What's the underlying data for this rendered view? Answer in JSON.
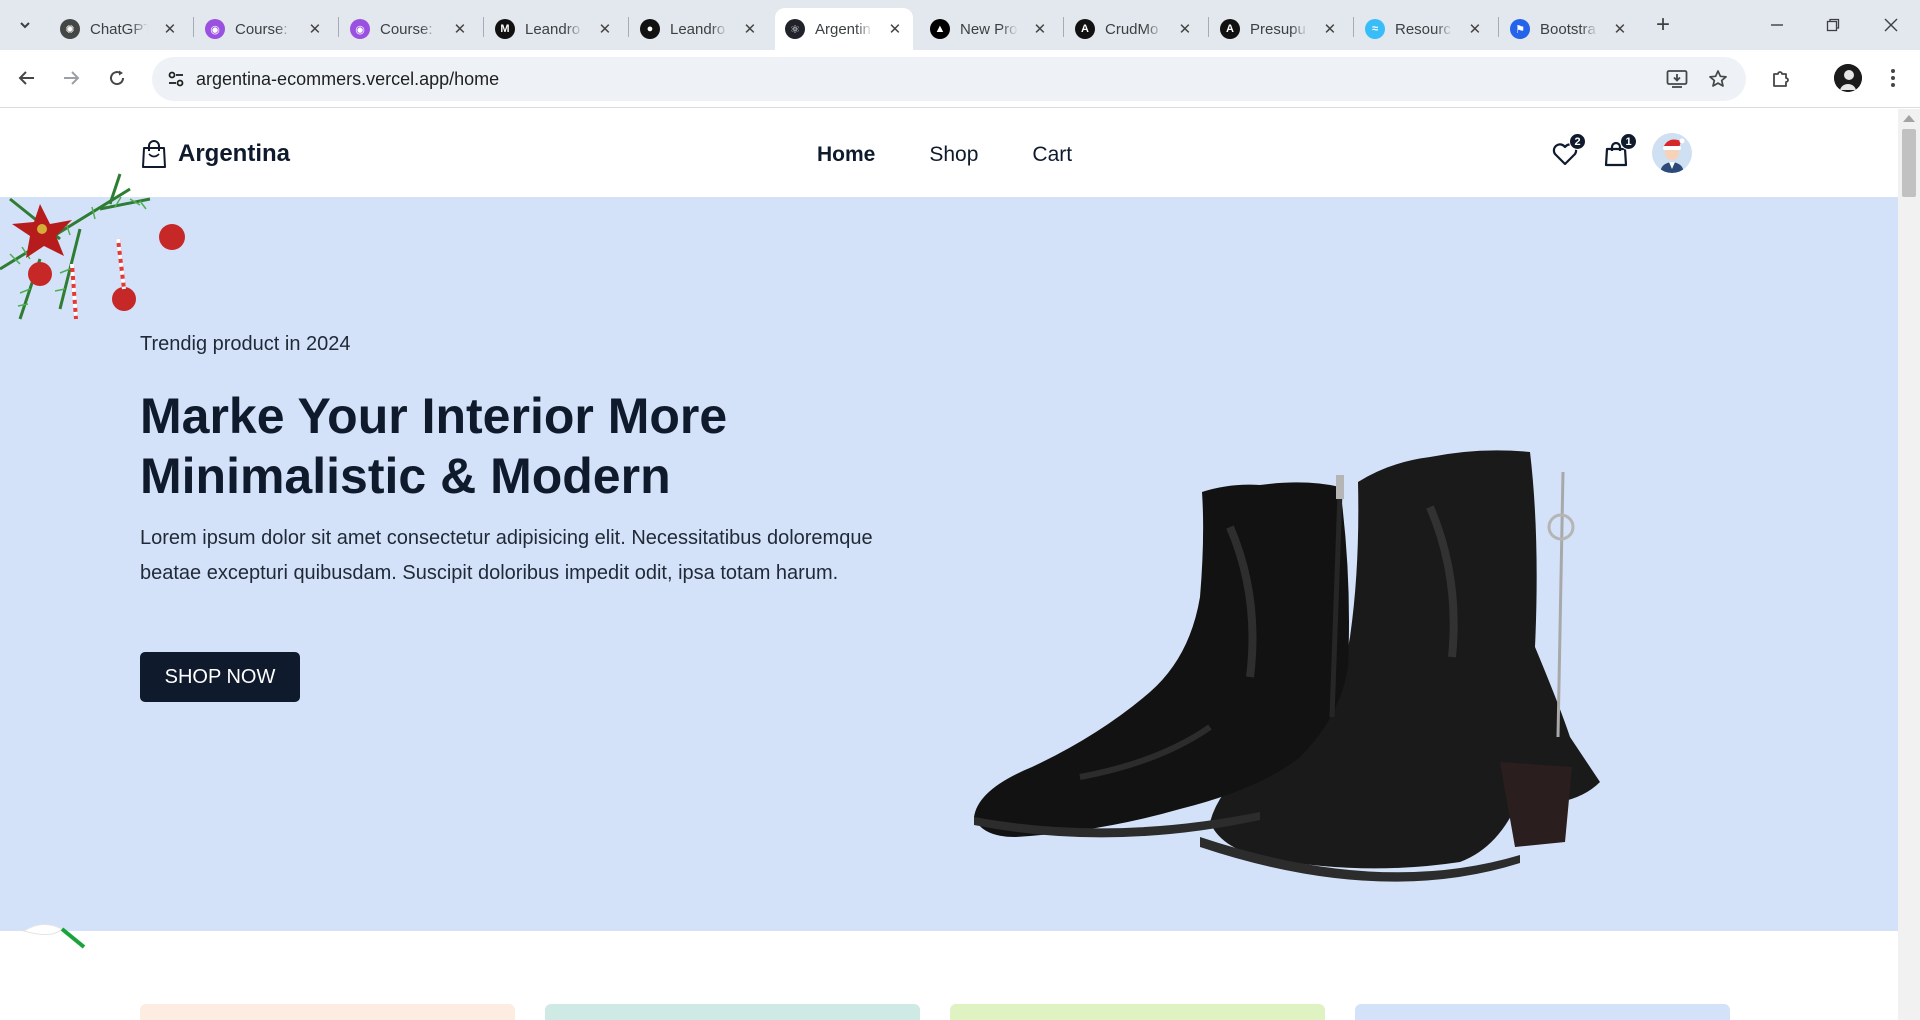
{
  "browser": {
    "tabs": [
      {
        "title": "ChatGPT",
        "icon": "chatgpt-icon",
        "color": "#444746"
      },
      {
        "title": "Course: ",
        "icon": "course-icon",
        "color": "#9b51e0"
      },
      {
        "title": "Course: ",
        "icon": "course-icon",
        "color": "#9b51e0"
      },
      {
        "title": "Leandro",
        "icon": "m-logo-icon",
        "color": "#111111"
      },
      {
        "title": "Leandro",
        "icon": "github-icon",
        "color": "#111111"
      },
      {
        "title": "Argentin",
        "icon": "react-icon",
        "color": "#20232a",
        "active": true
      },
      {
        "title": "New Pro",
        "icon": "vercel-icon",
        "color": "#000000"
      },
      {
        "title": "CrudMo",
        "icon": "angular-icon",
        "color": "#111111"
      },
      {
        "title": "Presupu",
        "icon": "angular-icon",
        "color": "#111111"
      },
      {
        "title": "Resourc",
        "icon": "tailwind-icon",
        "color": "#38bdf8"
      },
      {
        "title": "Bootstra",
        "icon": "flag-icon",
        "color": "#2563eb"
      }
    ],
    "url": "argentina-ecommers.vercel.app/home"
  },
  "site": {
    "brand": "Argentina",
    "nav": {
      "home": "Home",
      "shop": "Shop",
      "cart": "Cart"
    },
    "wishlist_count": "2",
    "cart_count": "1"
  },
  "hero": {
    "kicker": "Trendig product in 2024",
    "title": "Marke Your Interior More Minimalistic & Modern",
    "description": "Lorem ipsum dolor sit amet consectetur adipisicing elit. Necessitatibus doloremque beatae excepturi quibusdam. Suscipit doloribus impedit odit, ipsa totam harum.",
    "cta": "SHOP NOW"
  },
  "colors": {
    "hero_bg": "#d4e2f9",
    "primary": "#0f1b2d",
    "card_colors": [
      "#fdece2",
      "#cfe9e5",
      "#dff2c1",
      "#d4e2f9"
    ]
  }
}
